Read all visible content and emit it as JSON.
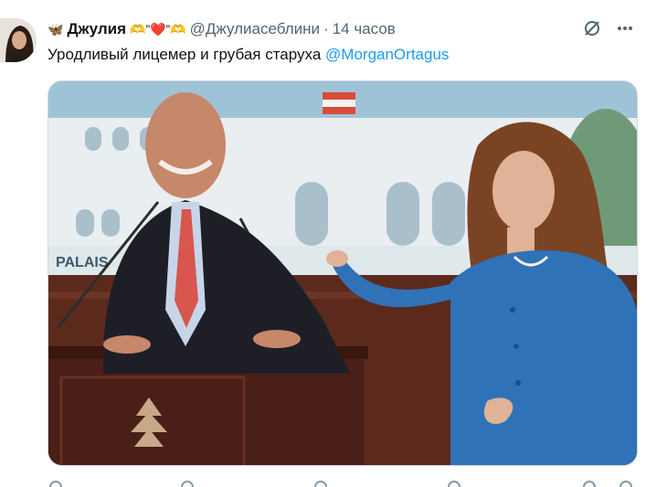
{
  "tweet": {
    "display_name": "Джулия",
    "name_emoji": "🦋",
    "name_decoration": "🫶”❤️”🫶",
    "handle": "@Джулиасеблини",
    "separator": "·",
    "time": "14 часов",
    "text": "Уродливый лицемер и грубая старуха ",
    "mention": "@MorganOrtagus",
    "photo": {
      "sign_text": "PALAIS",
      "description_icon": "photo"
    }
  },
  "colors": {
    "accent": "#1d9bf0",
    "muted": "#536471",
    "jacket_blue": "#2f72b8",
    "podium": "#4a1f17"
  },
  "icons": {
    "grok": "grok-icon",
    "more": "more-icon",
    "butterfly": "butterfly-icon"
  }
}
